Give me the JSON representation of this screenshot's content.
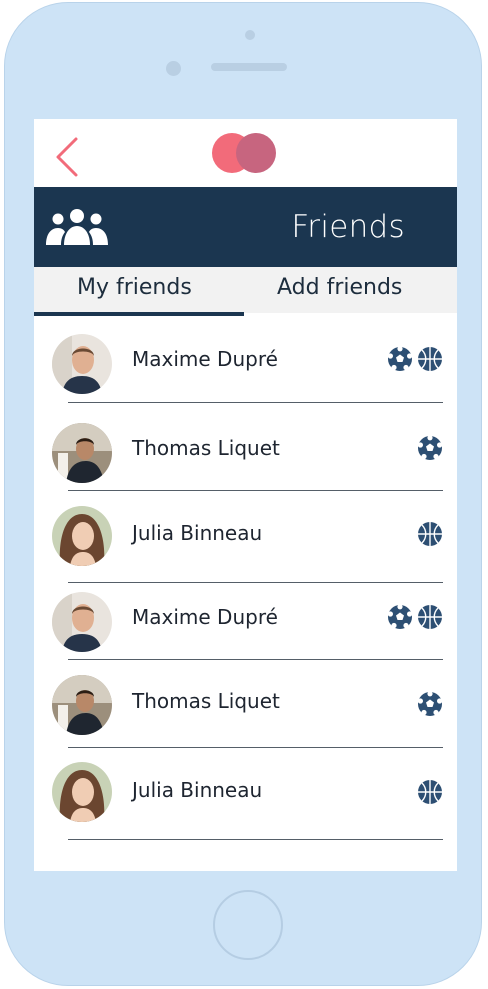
{
  "header": {
    "title": "Friends"
  },
  "tabs": [
    {
      "label": "My friends",
      "active": true
    },
    {
      "label": "Add friends",
      "active": false
    }
  ],
  "friends": [
    {
      "name": "Maxime Dupré",
      "sports": [
        "soccer-ball-icon",
        "basketball-icon"
      ]
    },
    {
      "name": "Thomas Liquet",
      "sports": [
        "soccer-ball-icon"
      ]
    },
    {
      "name": "Julia Binneau",
      "sports": [
        "basketball-icon"
      ]
    },
    {
      "name": "Maxime Dupré",
      "sports": [
        "soccer-ball-icon",
        "basketball-icon"
      ]
    },
    {
      "name": "Thomas Liquet",
      "sports": [
        "soccer-ball-icon"
      ]
    },
    {
      "name": "Julia Binneau",
      "sports": [
        "basketball-icon"
      ]
    }
  ],
  "colors": {
    "header_bg": "#1b3650",
    "accent_red": "#f26b7a",
    "accent_dark_pink": "#c7657f",
    "icon_blue": "#2d4f73",
    "device_bg": "#cde3f6"
  }
}
